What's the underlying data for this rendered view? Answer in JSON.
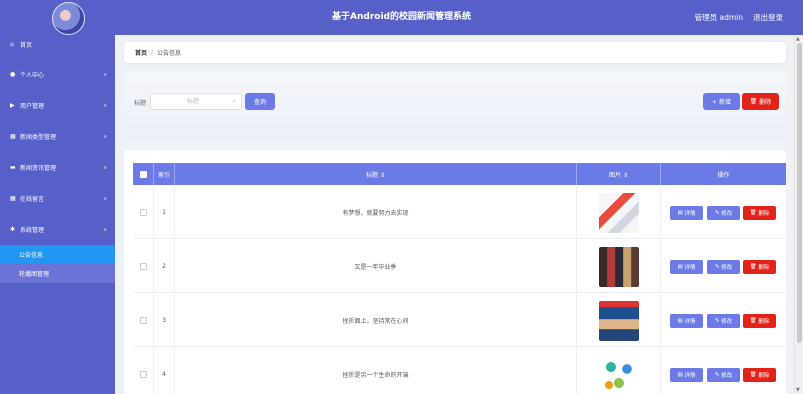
{
  "header": {
    "title": "基于Android的校园新闻管理系统",
    "admin_label": "管理员 admin",
    "logout_label": "退出登录"
  },
  "sidebar": {
    "items": [
      {
        "label": "首页",
        "icon": "home-icon",
        "has_chevron": false
      },
      {
        "label": "个人中心",
        "icon": "person-icon",
        "has_chevron": true
      },
      {
        "label": "用户管理",
        "icon": "flag-icon",
        "has_chevron": true
      },
      {
        "label": "新闻类型管理",
        "icon": "grid-icon",
        "has_chevron": true
      },
      {
        "label": "新闻资讯管理",
        "icon": "grid-icon",
        "has_chevron": true
      },
      {
        "label": "在线留言",
        "icon": "grid-icon",
        "has_chevron": true
      },
      {
        "label": "系统管理",
        "icon": "gear-icon",
        "has_chevron": true
      }
    ],
    "submenu": [
      {
        "label": "公告信息",
        "active": true
      },
      {
        "label": "轮播图管理",
        "active": false
      }
    ]
  },
  "breadcrumb": {
    "home": "首页",
    "separator": "/",
    "current": "公告信息"
  },
  "search": {
    "label": "标题",
    "placeholder": "标题",
    "query_button": "查询",
    "add_button": "+ 新增",
    "delete_button": "删除"
  },
  "table": {
    "columns": {
      "index": "索引",
      "title": "标题 ⇕",
      "image": "图片 ⇕",
      "actions": "操作"
    },
    "action_labels": {
      "detail": "详情",
      "edit": "修改",
      "delete": "删除"
    },
    "rows": [
      {
        "index": "1",
        "title": "有梦想，就要努力去实现"
      },
      {
        "index": "2",
        "title": "又是一年毕业季"
      },
      {
        "index": "3",
        "title": "挫折面上，坚持常在心间"
      },
      {
        "index": "4",
        "title": "挫折是另一个生命的开端"
      }
    ]
  },
  "colors": {
    "primary": "#5660c8",
    "button": "#6b7ae6",
    "danger": "#e2231a",
    "active_submenu": "#2196f3"
  }
}
